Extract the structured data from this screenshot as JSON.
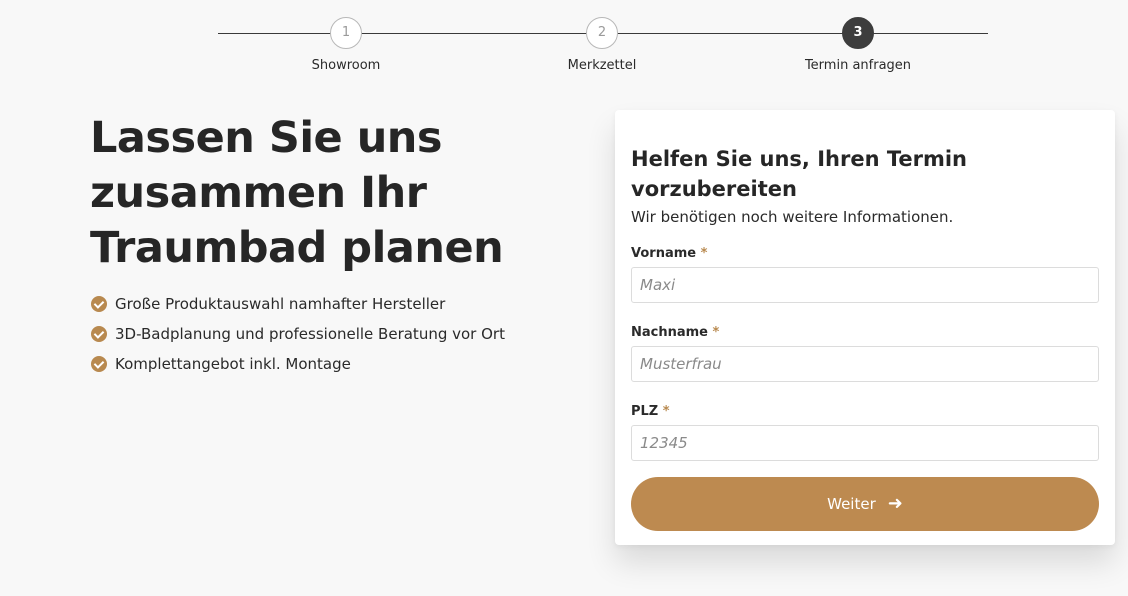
{
  "stepper": {
    "steps": [
      {
        "number": "1",
        "label": "Showroom"
      },
      {
        "number": "2",
        "label": "Merkzettel"
      },
      {
        "number": "3",
        "label": "Termin anfragen"
      }
    ],
    "active_step": "3"
  },
  "hero": {
    "title": "Lassen Sie uns zusammen Ihr Traumbad planen",
    "benefits": [
      "Große Produktauswahl namhafter Hersteller",
      "3D-Badplanung und professionelle Beratung vor Ort",
      "Komplettangebot inkl. Montage"
    ]
  },
  "form": {
    "title": "Helfen Sie uns, Ihren Termin vorzubereiten",
    "subtitle": "Wir benötigen noch weitere Informationen.",
    "fields": {
      "first_name": {
        "label": "Vorname",
        "required_mark": "*",
        "value": "",
        "placeholder": "Maxi"
      },
      "last_name": {
        "label": "Nachname",
        "required_mark": "*",
        "value": "",
        "placeholder": "Musterfrau"
      },
      "zip": {
        "label": "PLZ",
        "required_mark": "*",
        "value": "",
        "placeholder": "12345"
      }
    },
    "submit_label": "Weiter",
    "submit_icon": "arrow-right-icon"
  },
  "colors": {
    "accent": "#bd8a50",
    "check": "#b8894f",
    "step_active": "#3d3d3d",
    "background": "#f8f8f8"
  }
}
